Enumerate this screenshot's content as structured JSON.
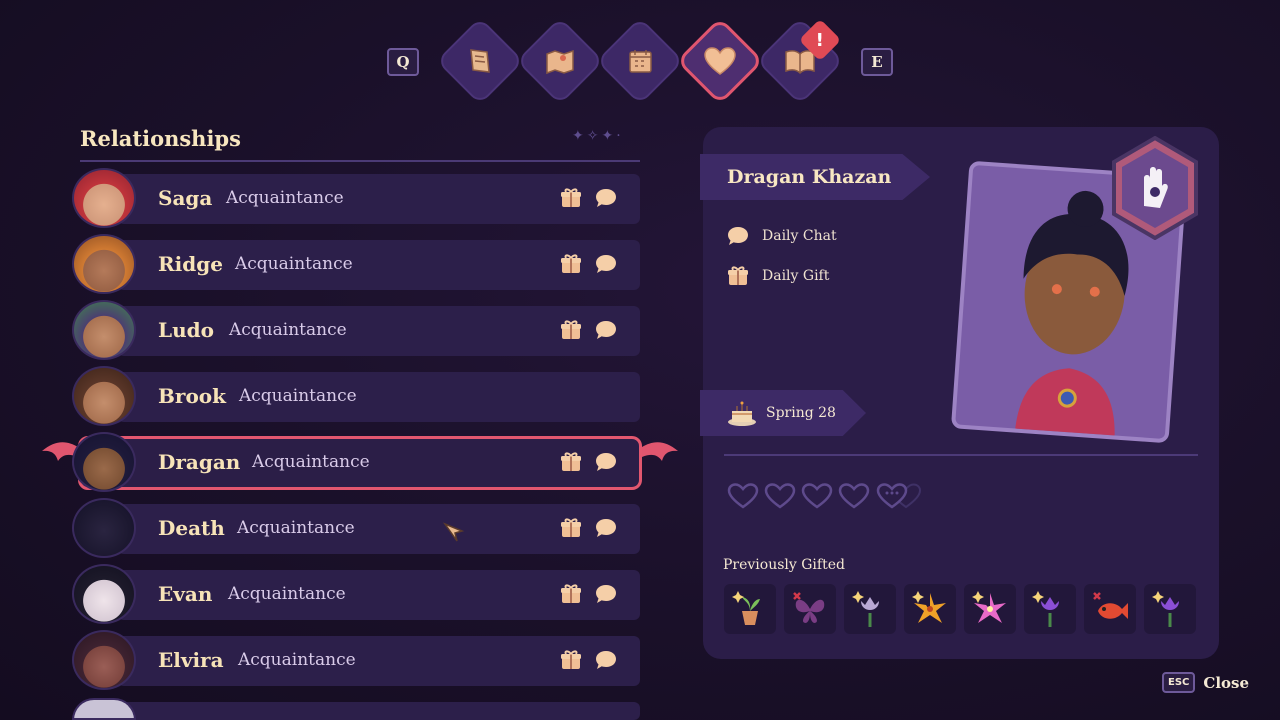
{
  "nav": {
    "prev_key": "Q",
    "next_key": "E",
    "tabs": [
      {
        "icon": "quest-scroll-icon"
      },
      {
        "icon": "map-icon"
      },
      {
        "icon": "calendar-icon"
      },
      {
        "icon": "heart-icon",
        "active": true
      },
      {
        "icon": "journal-book-icon",
        "alert": "!"
      }
    ]
  },
  "list": {
    "title": "Relationships",
    "rows": [
      {
        "name": "Saga",
        "status": "Acquaintance",
        "gift": true,
        "chat": true
      },
      {
        "name": "Ridge",
        "status": "Acquaintance",
        "gift": true,
        "chat": true
      },
      {
        "name": "Ludo",
        "status": "Acquaintance",
        "gift": true,
        "chat": true
      },
      {
        "name": "Brook",
        "status": "Acquaintance",
        "gift": false,
        "chat": false
      },
      {
        "name": "Dragan",
        "status": "Acquaintance",
        "gift": true,
        "chat": true,
        "selected": true
      },
      {
        "name": "Death",
        "status": "Acquaintance",
        "gift": true,
        "chat": true
      },
      {
        "name": "Evan",
        "status": "Acquaintance",
        "gift": true,
        "chat": true
      },
      {
        "name": "Elvira",
        "status": "Acquaintance",
        "gift": true,
        "chat": true
      }
    ]
  },
  "detail": {
    "name": "Dragan Khazan",
    "tasks": [
      {
        "icon": "chat-bubble-icon",
        "label": "Daily Chat"
      },
      {
        "icon": "gift-icon",
        "label": "Daily Gift"
      }
    ],
    "birthday": "Spring 28",
    "hearts": {
      "filled": 0,
      "shown": 4,
      "more": true
    },
    "previously_gifted_label": "Previously Gifted",
    "gifts": [
      {
        "icon": "sapling-pot-icon",
        "reaction": "liked"
      },
      {
        "icon": "butterfly-icon",
        "reaction": "disliked"
      },
      {
        "icon": "tulip-icon",
        "reaction": "liked"
      },
      {
        "icon": "lily-icon",
        "reaction": "liked"
      },
      {
        "icon": "pink-flower-icon",
        "reaction": "liked"
      },
      {
        "icon": "purple-tulip-icon",
        "reaction": "liked"
      },
      {
        "icon": "red-fish-icon",
        "reaction": "disliked"
      },
      {
        "icon": "purple-tulip-icon",
        "reaction": "liked"
      }
    ]
  },
  "footer": {
    "esc_key": "ESC",
    "close_label": "Close"
  },
  "colors": {
    "accent": "#e2576f",
    "panel": "#2b1d48",
    "row": "#2c1f4a",
    "text": "#f7e3b8"
  }
}
